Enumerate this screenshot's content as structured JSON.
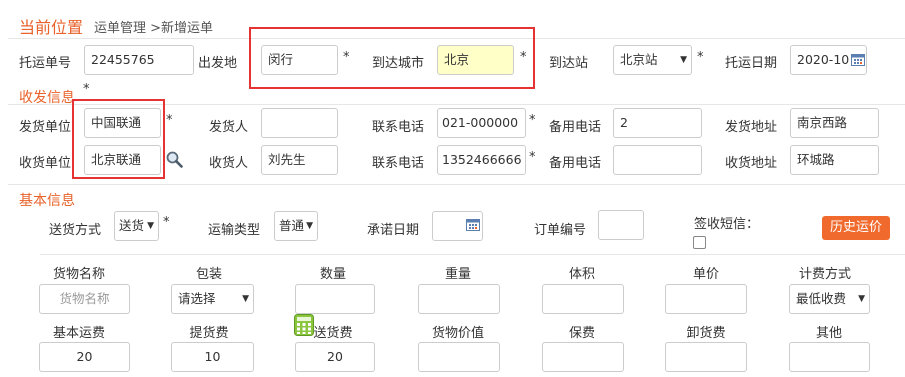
{
  "breadcrumb": {
    "title": "当前位置",
    "path": "运单管理 >新增运单"
  },
  "row1": {
    "order_no_label": "托运单号",
    "order_no_value": "22455765",
    "origin_label": "出发地",
    "origin_value": "闵行",
    "dest_city_label": "到达城市",
    "dest_city_value": "北京",
    "station_label": "到达站",
    "station_value": "北京站",
    "date_label": "托运日期",
    "date_value": "2020-10"
  },
  "section_ship": {
    "title": "收发信息"
  },
  "sender": {
    "unit_label": "发货单位",
    "unit_value": "中国联通",
    "person_label": "发货人",
    "person_value": "",
    "phone_label": "联系电话",
    "phone_value": "021-000000",
    "alt_phone_label": "备用电话",
    "alt_phone_value": "2",
    "address_label": "发货地址",
    "address_value": "南京西路"
  },
  "receiver": {
    "unit_label": "收货单位",
    "unit_value": "北京联通",
    "person_label": "收货人",
    "person_value": "刘先生",
    "phone_label": "联系电话",
    "phone_value": "1352466666",
    "alt_phone_label": "备用电话",
    "alt_phone_value": "",
    "address_label": "收货地址",
    "address_value": "环城路"
  },
  "section_basic": {
    "title": "基本信息"
  },
  "basic": {
    "delivery_label": "送货方式",
    "delivery_value": "送货",
    "transport_label": "运输类型",
    "transport_value": "普通",
    "promise_date_label": "承诺日期",
    "order_num_label": "订单编号",
    "sms_label": "签收短信：",
    "history_button": "历史运价"
  },
  "goods": {
    "headers": [
      "货物名称",
      "包装",
      "数量",
      "重量",
      "体积",
      "单价",
      "计费方式"
    ],
    "name_placeholder": "货物名称",
    "package_value": "请选择",
    "billing_value": "最低收费"
  },
  "fees": {
    "headers": [
      "基本运费",
      "提货费",
      "送货费",
      "货物价值",
      "保费",
      "卸货费",
      "其他"
    ],
    "values": [
      "20",
      "10",
      "20",
      "",
      "",
      "",
      ""
    ]
  },
  "star": "*",
  "colors": {
    "accent": "#e8622a",
    "highlight": "#e53333",
    "field_yellow": "#ffffc8"
  }
}
